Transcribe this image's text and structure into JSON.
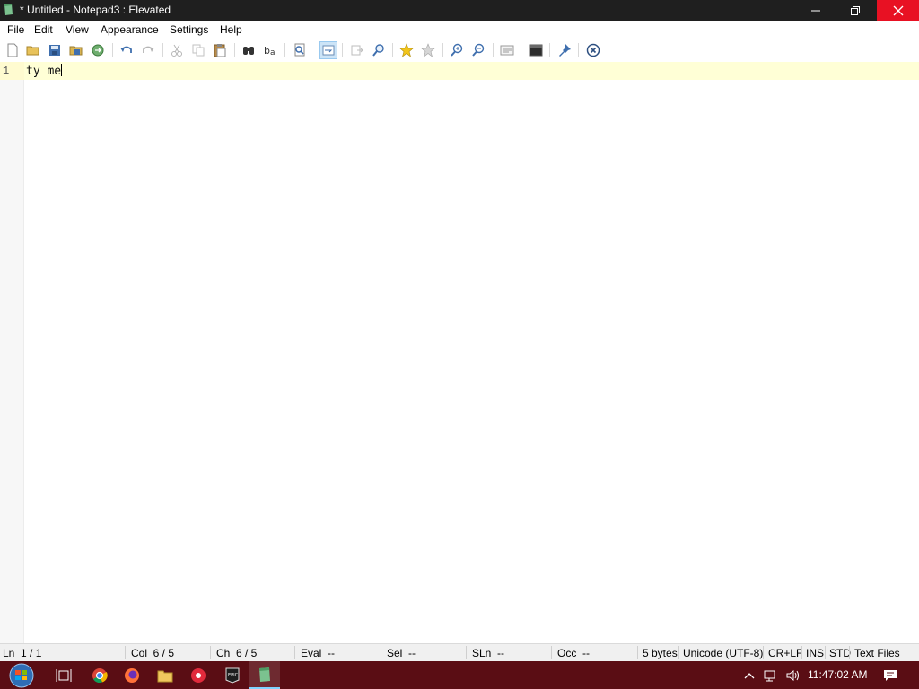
{
  "window": {
    "title": "* Untitled - Notepad3 : Elevated"
  },
  "menu": [
    "File",
    "Edit",
    "View",
    "Appearance",
    "Settings",
    "Help"
  ],
  "toolbar": [
    "new-file-icon",
    "open-file-icon",
    "save-icon",
    "save-as-icon",
    "browse-icon",
    "undo-icon",
    "redo-icon",
    "cut-icon",
    "copy-icon",
    "paste-icon",
    "find-icon",
    "replace-icon",
    "find-in-files-icon",
    "word-wrap-icon",
    "goto-icon",
    "zoom-find-icon",
    "favorite-icon",
    "add-favorite-icon",
    "zoom-in-icon",
    "zoom-out-icon",
    "schemes-icon",
    "console-icon",
    "pin-icon",
    "exit-icon"
  ],
  "editor": {
    "line_number": "1",
    "text": "ty me"
  },
  "status": {
    "ln": "Ln  1 / 1",
    "col": "Col  6 / 5",
    "ch": "Ch  6 / 5",
    "eval": "Eval  --",
    "sel": "Sel  --",
    "sln": "SLn  --",
    "occ": "Occ  --",
    "size": "5 bytes",
    "encoding": "Unicode (UTF-8)",
    "eol": "CR+LF",
    "ins": "INS",
    "std": "STD",
    "type": "Text Files"
  },
  "taskbar": {
    "apps": [
      "start-button",
      "task-view-icon",
      "chrome-icon",
      "firefox-icon",
      "file-explorer-icon",
      "app-red-icon",
      "epic-games-icon",
      "notepad3-icon"
    ],
    "clock": "11:47:02 AM"
  },
  "colors": {
    "title_bg": "#1f1f1f",
    "close_red": "#e81123",
    "taskbar_bg": "#5a0d14",
    "current_line": "#ffffd6"
  }
}
